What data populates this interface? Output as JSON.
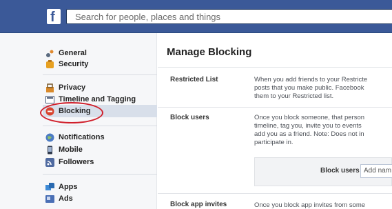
{
  "header": {
    "logo_letter": "f",
    "search_placeholder": "Search for people, places and things"
  },
  "sidebar": {
    "items": [
      {
        "label": "General",
        "icon": "gear-icon"
      },
      {
        "label": "Security",
        "icon": "badge-icon"
      },
      {
        "label": "Privacy",
        "icon": "lock-people-icon"
      },
      {
        "label": "Timeline and Tagging",
        "icon": "timeline-icon"
      },
      {
        "label": "Blocking",
        "icon": "block-icon"
      },
      {
        "label": "Notifications",
        "icon": "globe-icon"
      },
      {
        "label": "Mobile",
        "icon": "mobile-icon"
      },
      {
        "label": "Followers",
        "icon": "rss-icon"
      },
      {
        "label": "Apps",
        "icon": "apps-icon"
      },
      {
        "label": "Ads",
        "icon": "ads-icon"
      }
    ],
    "selected": "Blocking"
  },
  "main": {
    "title": "Manage Blocking",
    "sections": [
      {
        "label": "Restricted List",
        "desc": "When you add friends to your Restricte\nposts that you make public. Facebook\nthem to your Restricted list."
      },
      {
        "label": "Block users",
        "desc": "Once you block someone, that person\ntimeline, tag you, invite you to events\nadd you as a friend. Note: Does not in\nparticipate in."
      },
      {
        "label": "Block app invites",
        "desc": "Once you block app invites from some"
      }
    ],
    "block_users": {
      "label": "Block users",
      "input_value": "Add nam"
    }
  },
  "colors": {
    "facebook_blue": "#3b5998",
    "annotation_red": "#d01f2b",
    "selected_bg": "#d8dfea"
  }
}
